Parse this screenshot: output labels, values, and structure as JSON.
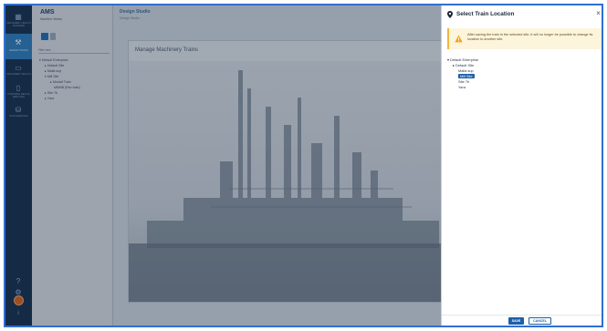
{
  "app": {
    "brand": "AMS",
    "brand_sub": "Machine Works"
  },
  "rail": {
    "items": [
      {
        "label": "MACHINERY HEALTH MANAGER",
        "icon": "grid-icon"
      },
      {
        "label": "DESIGN STUDIO",
        "icon": "wrench-icon",
        "active": true
      },
      {
        "label": "MACHINERY HEALTH",
        "icon": "site-icon"
      },
      {
        "label": "PORTABLE DEVICE SERVICES",
        "icon": "device-icon"
      },
      {
        "label": "DATA SERVICES",
        "icon": "data-icon"
      }
    ]
  },
  "tree": {
    "filter_label": "Filter tree",
    "nodes": [
      {
        "label": "Default Enterprise",
        "icon": "chevron-down-icon"
      },
      {
        "label": "Default Site",
        "icon": "chevron-right-icon"
      },
      {
        "label": "Malla sup",
        "icon": "chevron-right-icon"
      },
      {
        "label": "Mill Site",
        "icon": "chevron-down-icon"
      },
      {
        "label": "Montaf Train",
        "icon": "chevron-right-icon"
      },
      {
        "label": "MMNB (Rev train)",
        "icon": ""
      },
      {
        "label": "Site 7b",
        "icon": "chevron-right-icon"
      },
      {
        "label": "Yara",
        "icon": "chevron-right-icon"
      }
    ]
  },
  "main": {
    "title": "Design Studio",
    "breadcrumb": "Design Studio",
    "card_title": "Manage Machinery Trains"
  },
  "dialog": {
    "title": "Select Train Location",
    "warning": "After saving the train in the selected site, it will no longer be possible to change its location to another site.",
    "tree": [
      {
        "label": "Default Enterprise",
        "icon": "chevron-down-icon"
      },
      {
        "label": "Default Site",
        "icon": "chevron-right-icon"
      },
      {
        "label": "Malla sup",
        "icon": ""
      },
      {
        "label": "Mill Site",
        "icon": "",
        "selected": true
      },
      {
        "label": "Site 7b",
        "icon": ""
      },
      {
        "label": "Yara",
        "icon": ""
      }
    ],
    "save_label": "SAVE",
    "cancel_label": "CANCEL"
  },
  "colors": {
    "primary": "#1c5fa8",
    "rail": "#16324f",
    "warning_bg": "#fdf4dc",
    "warning_icon": "#f2a11e"
  }
}
